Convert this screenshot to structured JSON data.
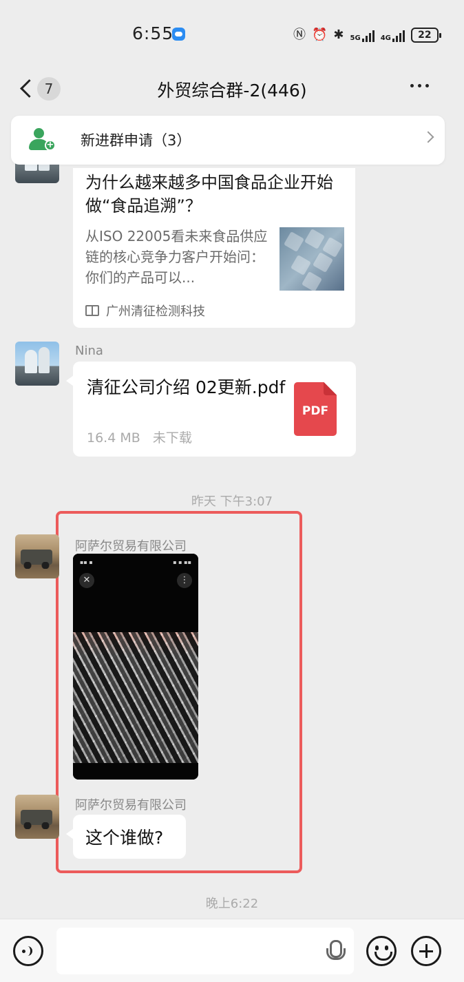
{
  "status_bar": {
    "time": "6:55",
    "net_5g": "5G",
    "net_4g": "4G",
    "battery": "22",
    "icons": [
      "app-notification-icon",
      "nfc-icon",
      "alarm-icon",
      "bluetooth-icon",
      "signal-5g-icon",
      "signal-4g-icon",
      "battery-icon"
    ]
  },
  "nav": {
    "unread_count": "7",
    "title": "外贸综合群-2(446)"
  },
  "join_banner": {
    "label": "新进群申请（3）"
  },
  "messages": {
    "article": {
      "title": "为什么越来越多中国食品企业开始做“食品追溯”？",
      "description": "从ISO 22005看未来食品供应链的核心竞争力客户开始问：你们的产品可以...",
      "source": "广州清征检测科技"
    },
    "file": {
      "sender": "Nina",
      "file_name": "清征公司介绍 02更新.pdf",
      "size": "16.4 MB",
      "status": "未下载",
      "type_label": "PDF"
    },
    "timestamp_1": "昨天 下午3:07",
    "image_msg": {
      "sender": "阿萨尔贸易有限公司"
    },
    "text_msg": {
      "sender": "阿萨尔贸易有限公司",
      "text": "这个谁做?"
    },
    "timestamp_2": "晚上6:22"
  },
  "colors": {
    "background": "#ededed",
    "bubble": "#ffffff",
    "highlight_border": "#ec5b5b",
    "join_icon": "#3aa55d",
    "pdf_icon": "#e5484d"
  }
}
